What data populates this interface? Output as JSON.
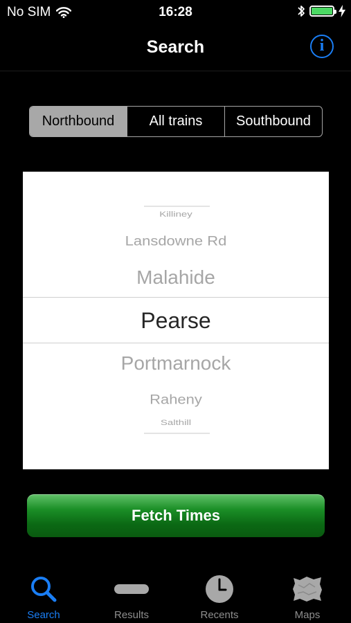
{
  "status_bar": {
    "carrier": "No SIM",
    "time": "16:28",
    "battery_level": 1.0
  },
  "nav": {
    "title": "Search",
    "info_icon": "info-circle-icon",
    "info_glyph": "i"
  },
  "direction_segments": [
    {
      "label": "Northbound",
      "selected": true
    },
    {
      "label": "All trains",
      "selected": false
    },
    {
      "label": "Southbound",
      "selected": false
    }
  ],
  "station_picker": {
    "items": [
      "Killiney",
      "Lansdowne Rd",
      "Malahide",
      "Pearse",
      "Portmarnock",
      "Raheny",
      "Salthill"
    ],
    "selected": "Pearse"
  },
  "fetch_button": {
    "label": "Fetch Times"
  },
  "tab_bar": {
    "tabs": [
      {
        "label": "Search",
        "icon": "search-icon",
        "active": true
      },
      {
        "label": "Results",
        "icon": "results-icon",
        "active": false
      },
      {
        "label": "Recents",
        "icon": "clock-icon",
        "active": false
      },
      {
        "label": "Maps",
        "icon": "map-icon",
        "active": false
      }
    ]
  },
  "colors": {
    "accent": "#1a7ef5",
    "fetch_green": "#0b6914",
    "battery_green": "#4cd964"
  }
}
